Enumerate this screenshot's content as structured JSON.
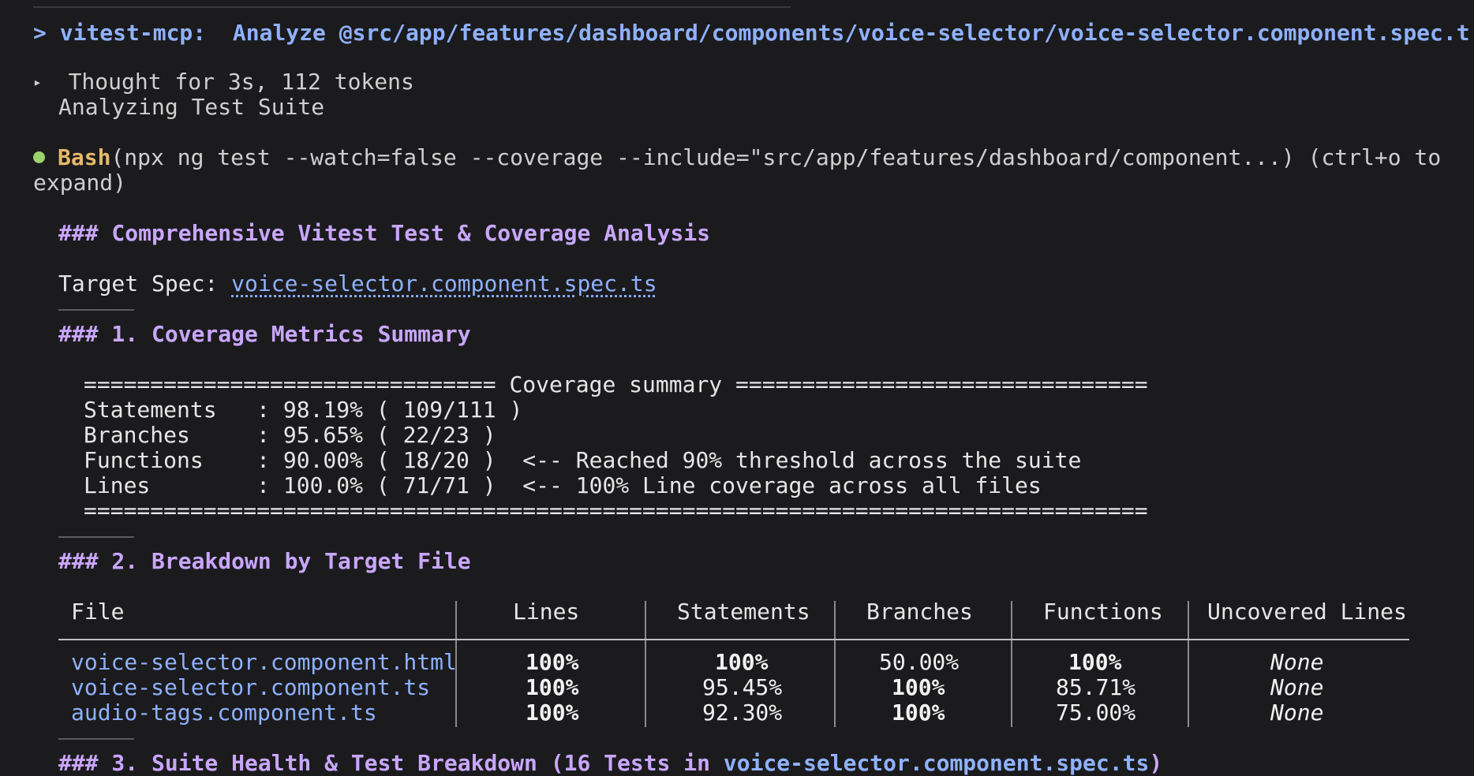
{
  "command": {
    "prompt_symbol": ">",
    "tool": "vitest-mcp:",
    "action": "Analyze @src/app/features/dashboard/components/voice-selector/voice-selector.component.spec.ts"
  },
  "thought": {
    "toggle_glyph": "▸",
    "summary": "Thought for 3s, 112 tokens",
    "detail": "Analyzing Test Suite"
  },
  "bash": {
    "name": "Bash",
    "args_line1": "(npx ng test --watch=false --coverage --include=\"src/app/features/dashboard/component...) (ctrl+o to",
    "args_line2": "expand)"
  },
  "report": {
    "title": "### Comprehensive Vitest Test & Coverage Analysis",
    "target_label": "Target Spec: ",
    "target_file": "voice-selector.component.spec.ts",
    "section1_title": "### 1. Coverage Metrics Summary",
    "coverage_lines": [
      "=============================== Coverage summary ===============================",
      "Statements   : 98.19% ( 109/111 )",
      "Branches     : 95.65% ( 22/23 )",
      "Functions    : 90.00% ( 18/20 )  <-- Reached 90% threshold across the suite",
      "Lines        : 100.0% ( 71/71 )  <-- 100% Line coverage across all files",
      "================================================================================"
    ],
    "section2_title": "### 2. Breakdown by Target File",
    "table": {
      "headers": [
        "File",
        "Lines",
        "Statements",
        "Branches",
        "Functions",
        "Uncovered Lines"
      ],
      "rows": [
        [
          "voice-selector.component.html",
          "100%",
          "100%",
          "50.00%",
          "100%",
          "None"
        ],
        [
          "voice-selector.component.ts",
          "100%",
          "95.45%",
          "100%",
          "85.71%",
          "None"
        ],
        [
          "audio-tags.component.ts",
          "100%",
          "92.30%",
          "100%",
          "75.00%",
          "None"
        ]
      ]
    },
    "section3_prefix": "### 3. Suite Health & Test Breakdown (16 Tests in ",
    "section3_file": "voice-selector.component.spec.ts",
    "section3_suffix": ")"
  },
  "colors": {
    "background": "#1b1b1d",
    "prompt_blue": "#8fb1ff",
    "heading_purple": "#c9a6ff",
    "bash_orange": "#e5b96a",
    "status_green": "#9bd26b"
  }
}
